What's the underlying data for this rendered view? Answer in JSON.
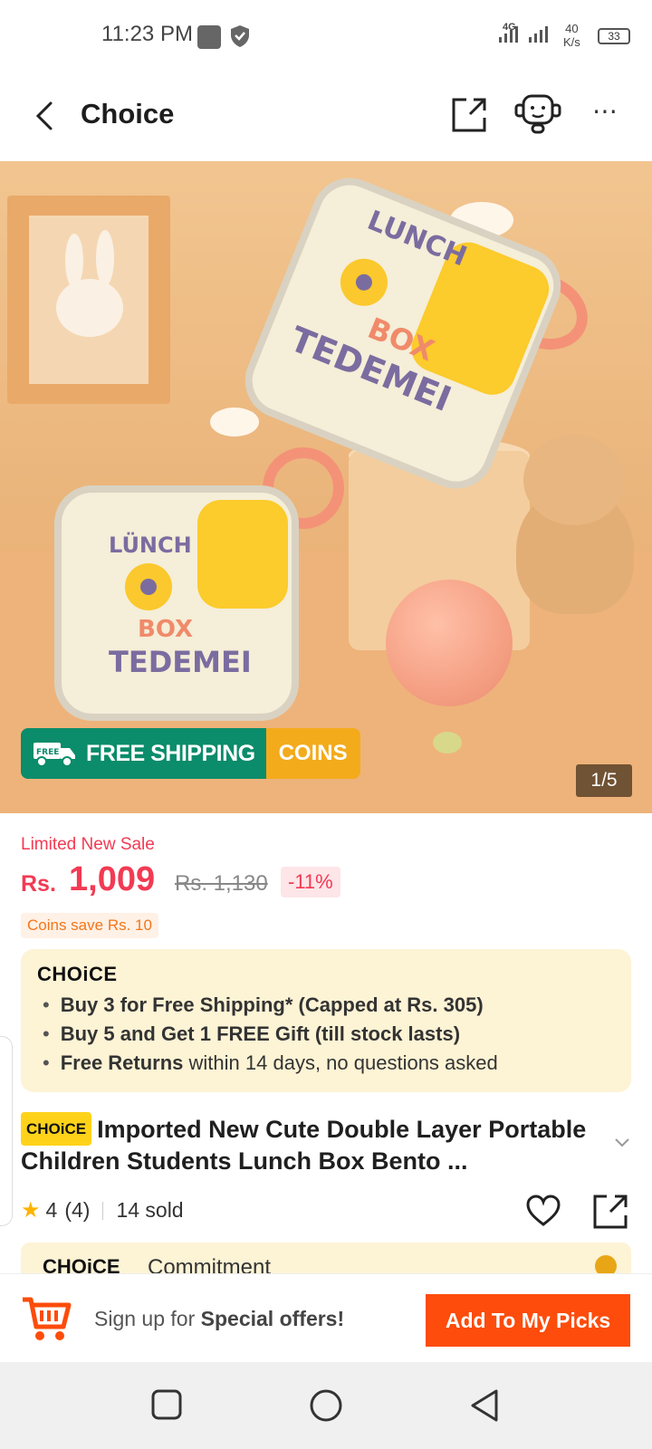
{
  "status_bar": {
    "time": "11:23 PM",
    "network": "4G",
    "speed_value": "40",
    "speed_unit": "K/s",
    "battery": "33"
  },
  "header": {
    "title": "Choice",
    "icons": [
      "back-arrow-icon",
      "share-icon",
      "customer-service-icon",
      "more-icon"
    ]
  },
  "gallery": {
    "counter": "1/5",
    "badge_free_shipping": "FREE SHIPPING",
    "badge_coins": "COINS",
    "truck_label": "FREE",
    "image_text": {
      "box1_line1": "LUNCH",
      "box1_line2": "BOX",
      "box1_line3": "TEDEMEI",
      "box2_line1": "LÜNCH",
      "box2_line2": "BOX",
      "box2_line3": "TEDEMEI"
    }
  },
  "pricing": {
    "sale_label": "Limited New Sale",
    "currency": "Rs.",
    "price": "1,009",
    "original_price": "Rs. 1,130",
    "discount": "-11%",
    "coins_save": "Coins save Rs. 10"
  },
  "choice_card": {
    "logo": "CHOiCE",
    "items": [
      {
        "bold": "Buy 3 for  Free Shipping* (Capped at Rs. 305)",
        "rest": ""
      },
      {
        "bold": "Buy 5 and Get 1 FREE Gift (till stock lasts)",
        "rest": ""
      },
      {
        "bold": "Free Returns",
        "rest": " within 14 days, no questions asked"
      }
    ]
  },
  "product": {
    "badge": "CHOiCE",
    "title": "Imported New Cute Double Layer Portable Children Students Lunch Box Bento ...",
    "rating": "4",
    "review_count": "(4)",
    "sold": "14 sold"
  },
  "commitment": {
    "logo": "CHOiCE",
    "label": "Commitment"
  },
  "action_bar": {
    "signup_prefix": "Sign up for ",
    "signup_bold": "Special offers!",
    "add_button": "Add To My Picks"
  },
  "colors": {
    "accent_red": "#f23a53",
    "button_orange": "#fd4c0b",
    "choice_yellow": "#ffd21a",
    "free_shipping_green": "#0b8c6a",
    "coins_orange": "#f3ab1c"
  }
}
